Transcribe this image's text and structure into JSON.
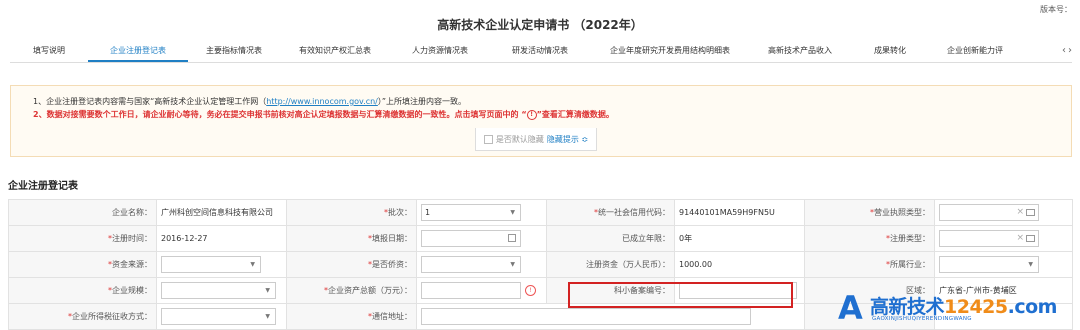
{
  "version_label": "版本号：",
  "title": "高新技术企业认定申请书 （2022年）",
  "tabs": [
    {
      "label": "填写说明",
      "active": false
    },
    {
      "label": "企业注册登记表",
      "active": true
    },
    {
      "label": "主要指标情况表",
      "active": false
    },
    {
      "label": "有效知识产权汇总表",
      "active": false
    },
    {
      "label": "人力资源情况表",
      "active": false
    },
    {
      "label": "研发活动情况表",
      "active": false
    },
    {
      "label": "企业年度研究开发费用结构明细表",
      "active": false
    },
    {
      "label": "高新技术产品收入",
      "active": false
    },
    {
      "label": "成果转化",
      "active": false
    },
    {
      "label": "企业创新能力评",
      "active": false
    }
  ],
  "tab_prev": "‹",
  "tab_next": "›",
  "notice": {
    "line1_a": "1、企业注册登记表内容需与国家“高新技术企业认定管理工作网（",
    "line1_link": "http://www.innocom.gov.cn/",
    "line1_b": "）”上所填注册内容一致。",
    "line2_a": "2、数据对接需要数个工作日，请企业耐心等待，务必在提交申报书前核对高企认定填报数据与汇算清缴数据的一致性。点击填写页面中的 “",
    "line2_icon": "!",
    "line2_b": "”查看汇算清缴数据。"
  },
  "toggle": {
    "checkbox_label": "是否默认隐藏",
    "hide_tip": "隐藏提示 ≎"
  },
  "section_title": "企业注册登记表",
  "form": {
    "company_name_label": "企业名称：",
    "company_name": "广州科创空间信息科技有限公司",
    "batch_label": "批次：",
    "batch": "1",
    "credit_code_label": "统一社会信用代码：",
    "credit_code": "91440101MA59H9FN5U",
    "license_type_label": "营业执照类型：",
    "reg_time_label": "注册时间：",
    "reg_time": "2016-12-27",
    "fill_date_label": "填报日期：",
    "established_label": "已成立年限：",
    "established": "0年",
    "reg_type_label": "注册类型：",
    "fund_source_label": "资金来源：",
    "overseas_label": "是否侨资：",
    "reg_capital_label": "注册资金（万人民币）：",
    "reg_capital": "1000.00",
    "industry_label": "所属行业：",
    "scale_label": "企业规模：",
    "assets_label": "企业资产总额（万元）：",
    "smb_label": "科小备案编号：",
    "region_label": "区域：",
    "region": "广东省-广州市-黄埔区",
    "tax_method_label": "企业所得税征收方式：",
    "address_label": "通信地址："
  },
  "watermark": {
    "text_a": "高新技术",
    "text_b": "12425",
    "text_c": ".com",
    "sub": "GAOXINJISHUQIYERENDINGWANG",
    "letter": "A"
  },
  "colors": {
    "accent": "#1f7fc4",
    "required": "#dd3333",
    "highlight": "#d32222"
  }
}
